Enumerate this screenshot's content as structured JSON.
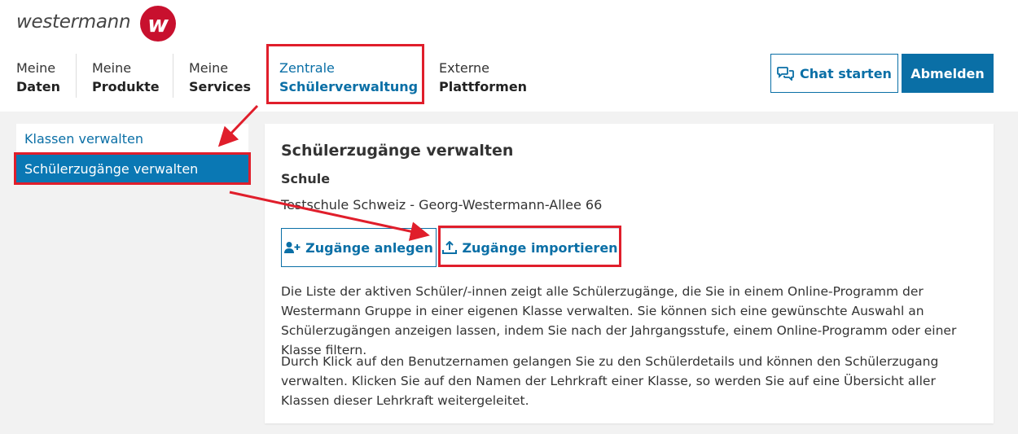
{
  "brand": {
    "name": "westermann",
    "badge_letter": "w",
    "color": "#c8102e"
  },
  "nav": [
    {
      "line1": "Meine",
      "line2": "Daten"
    },
    {
      "line1": "Meine",
      "line2": "Produkte"
    },
    {
      "line1": "Meine",
      "line2": "Services"
    },
    {
      "line1": "Zentrale",
      "line2": "Schülerverwaltung",
      "active": true
    },
    {
      "line1": "Externe",
      "line2": "Plattformen"
    }
  ],
  "header_buttons": {
    "chat": "Chat starten",
    "logout": "Abmelden"
  },
  "sidebar": {
    "items": [
      {
        "label": "Klassen verwalten"
      },
      {
        "label": "Schülerzugänge verwalten",
        "active": true
      }
    ]
  },
  "main": {
    "title": "Schülerzugänge verwalten",
    "school_label": "Schule",
    "school_value": "Testschule Schweiz - Georg-Westermann-Allee 66",
    "buttons": {
      "create": "Zugänge anlegen",
      "import": "Zugänge importieren"
    },
    "paragraph1": "Die Liste der aktiven Schüler/-innen zeigt alle Schülerzugänge, die Sie in einem Online-Programm der Westermann Gruppe in einer eigenen Klasse verwalten. Sie können sich eine gewünschte Auswahl an Schülerzugängen anzeigen lassen, indem Sie nach der Jahrgangsstufe, einem Online-Programm oder einer Klasse filtern.",
    "paragraph2": "Durch Klick auf den Benutzernamen gelangen Sie zu den Schülerdetails und können den Schülerzugang verwalten. Klicken Sie auf den Namen der Lehrkraft einer Klasse, so werden Sie auf eine Übersicht aller Klassen dieser Lehrkraft weitergeleitet."
  },
  "colors": {
    "accent": "#0a6fa6",
    "highlight": "#e01e2b"
  }
}
